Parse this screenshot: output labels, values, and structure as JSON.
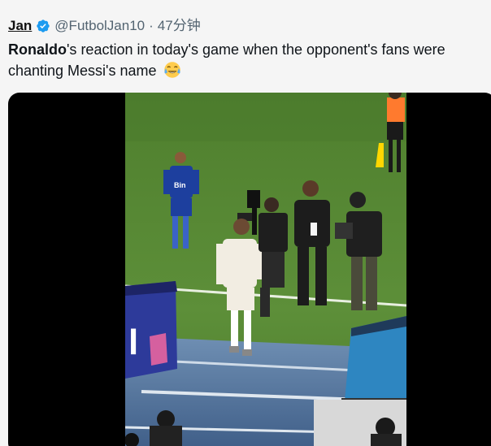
{
  "tweet": {
    "author_name": "Jan",
    "handle": "@FutbolJan10",
    "separator": "·",
    "time": "47分钟",
    "text_bold": "Ronaldo",
    "text_rest": "'s reaction in today's game when the opponent's fans were chanting Messi's name",
    "emoji_icon": "face-with-tears-of-joy-icon",
    "verified_icon": "verified-badge-icon"
  },
  "media": {
    "type": "video",
    "jersey_sponsor": "Bin"
  },
  "colors": {
    "verified": "#1d9bf0",
    "pitch": "#5a8a3a",
    "text": "#0f1419",
    "muted": "#536471"
  }
}
